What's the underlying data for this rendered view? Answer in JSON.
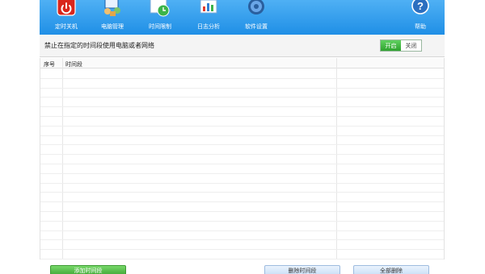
{
  "toolbar": {
    "items": [
      {
        "label": "定时关机",
        "icon": "power-icon"
      },
      {
        "label": "电脑管理",
        "icon": "computer-manage-icon"
      },
      {
        "label": "时间限制",
        "icon": "clock-icon"
      },
      {
        "label": "日志分析",
        "icon": "log-analysis-icon"
      },
      {
        "label": "软件设置",
        "icon": "gear-icon"
      },
      {
        "label": "帮助",
        "icon": "help-icon"
      }
    ],
    "bg_color": "#2796e9"
  },
  "section": {
    "title": "禁止在指定的时间段使用电脑或者网络",
    "toggle": {
      "on_label": "开启",
      "off_label": "关闭",
      "state": "on"
    }
  },
  "table": {
    "columns": [
      "序号",
      "时间段"
    ],
    "rows": []
  },
  "buttons": {
    "add": "添加时间段",
    "delete": "删除时间段",
    "clear": "全部删除"
  },
  "colors": {
    "accent_green": "#3da534",
    "toolbar_blue": "#2796e9"
  }
}
